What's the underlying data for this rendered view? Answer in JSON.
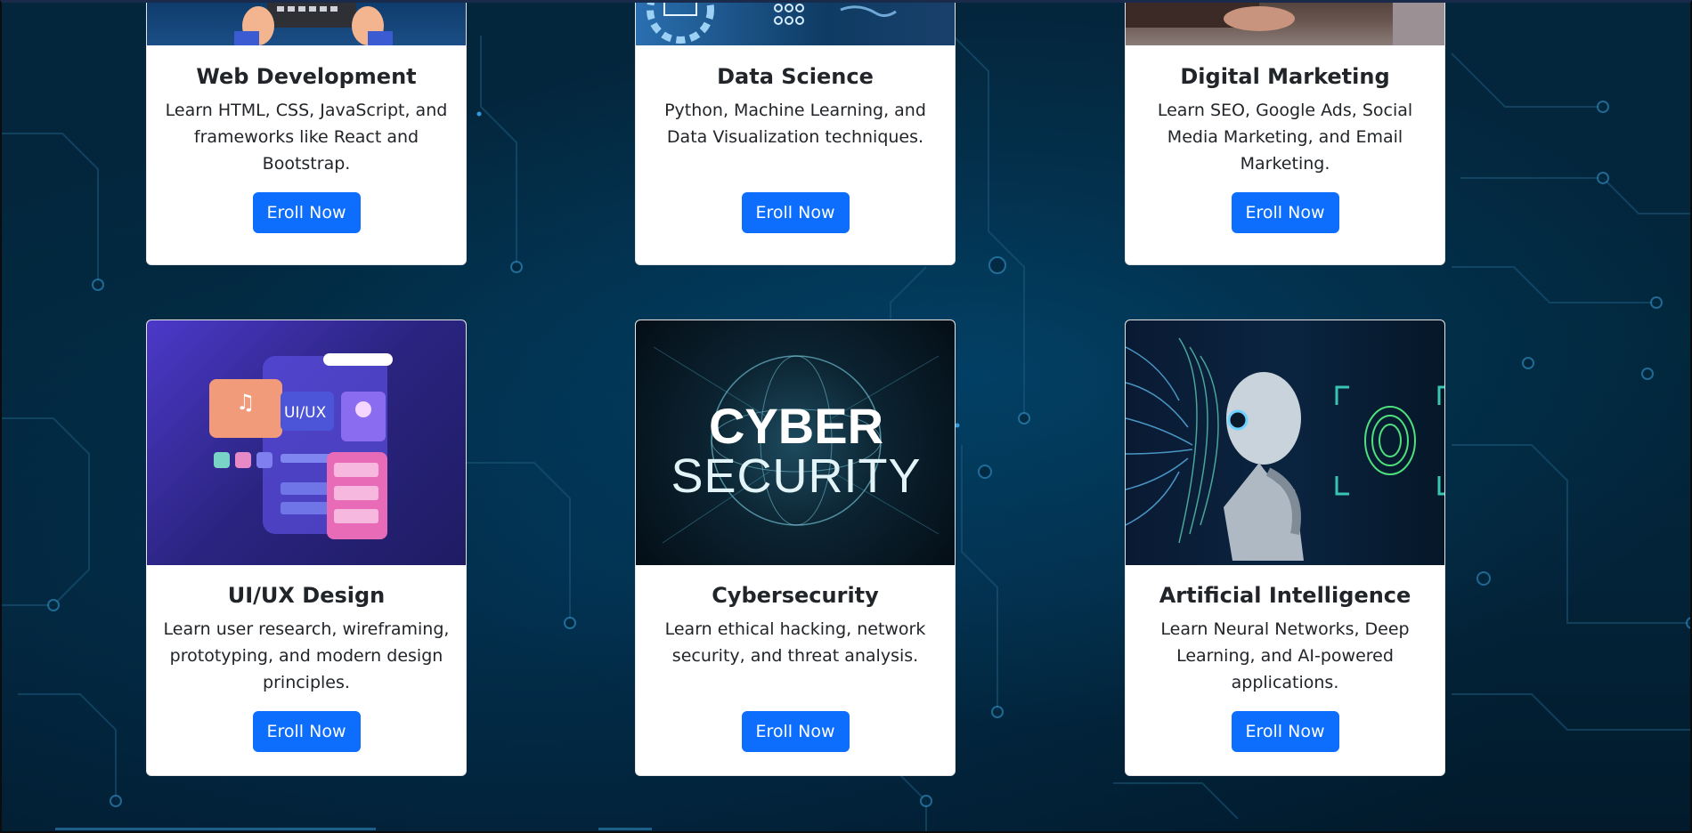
{
  "courses_row1": [
    {
      "title": "Web Development",
      "description": "Learn HTML, CSS, JavaScript, and frameworks like React and Bootstrap.",
      "button": "Eroll Now",
      "image_icon": "keyboard-hands-image"
    },
    {
      "title": "Data Science",
      "description": "Python, Machine Learning, and Data Visualization techniques.",
      "button": "Eroll Now",
      "image_icon": "data-gear-image"
    },
    {
      "title": "Digital Marketing",
      "description": "Learn SEO, Google Ads, Social Media Marketing, and Email Marketing.",
      "button": "Eroll Now",
      "image_icon": "desk-hand-image"
    }
  ],
  "courses_row2": [
    {
      "title": "UI/UX Design",
      "description": "Learn user research, wireframing, prototyping, and modern design principles.",
      "button": "Eroll Now",
      "image_text": "UI/UX",
      "image_icon": "uiux-illustration-image"
    },
    {
      "title": "Cybersecurity",
      "description": "Learn ethical hacking, network security, and threat analysis.",
      "button": "Eroll Now",
      "image_text_line1": "CYBER",
      "image_text_line2": "SECURITY",
      "image_icon": "cyber-globe-image"
    },
    {
      "title": "Artificial Intelligence",
      "description": "Learn Neural Networks, Deep Learning, and AI-powered applications.",
      "button": "Eroll Now",
      "image_icon": "ai-robot-image"
    }
  ],
  "colors": {
    "background": "#032338",
    "button": "#0d6efd",
    "card": "#ffffff",
    "text": "#212529"
  }
}
